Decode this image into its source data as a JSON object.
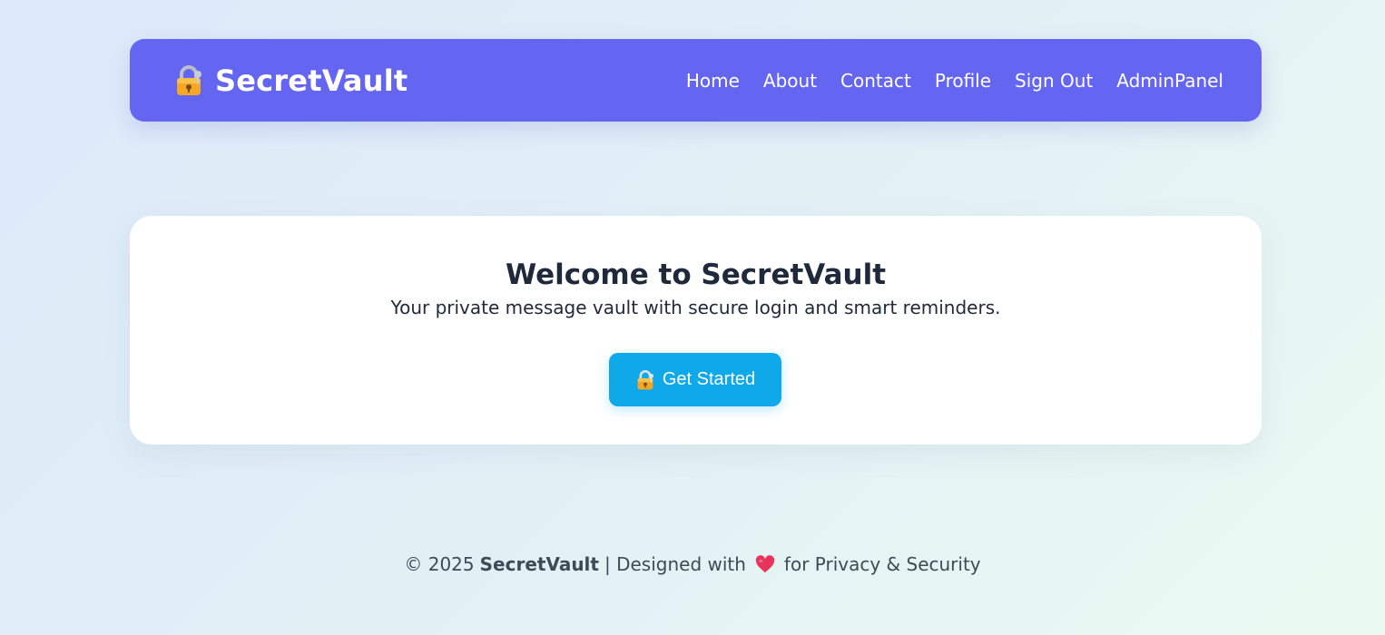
{
  "navbar": {
    "brand_icon": "lock-icon",
    "brand_name": "SecretVault",
    "links": [
      "Home",
      "About",
      "Contact",
      "Profile",
      "Sign Out",
      "AdminPanel"
    ]
  },
  "hero": {
    "title": "Welcome to SecretVault",
    "subtitle": "Your private message vault with secure login and smart reminders.",
    "cta_icon": "lock-icon",
    "cta_label": "Get Started"
  },
  "footer": {
    "prefix": "© 2025",
    "brand": "SecretVault",
    "middle": "| Designed with",
    "heart_icon": "heart-icon",
    "suffix": "for Privacy & Security"
  },
  "colors": {
    "navbar_bg": "#6466f1",
    "cta_bg": "#0fa8e9",
    "title_text": "#1e293b",
    "heart": "#e8345b"
  }
}
